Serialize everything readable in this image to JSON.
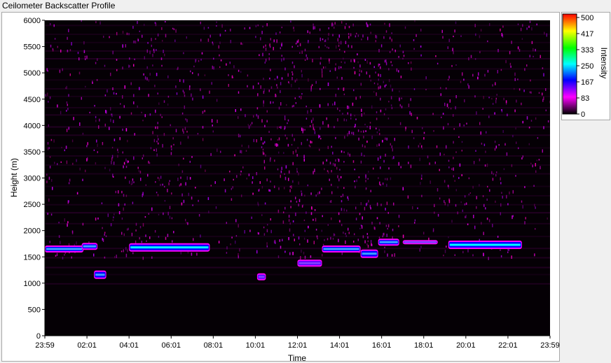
{
  "window": {
    "title": "Ceilometer Backscatter Profile"
  },
  "chart_data": {
    "type": "heatmap",
    "title": "Ceilometer Backscatter Profile",
    "xlabel": "Time",
    "ylabel": "Height (m)",
    "x_ticks": [
      "23:59",
      "02:01",
      "04:01",
      "06:01",
      "08:01",
      "10:01",
      "12:01",
      "14:01",
      "16:01",
      "18:01",
      "20:01",
      "22:01",
      "23:59"
    ],
    "y_ticks": [
      0,
      500,
      1000,
      1500,
      2000,
      2500,
      3000,
      3500,
      4000,
      4500,
      5000,
      5500,
      6000
    ],
    "ylim": [
      0,
      6000
    ],
    "colorbar": {
      "label": "Intensity",
      "ticks": [
        "500",
        "417",
        "333",
        "250",
        "167",
        "83",
        "0"
      ],
      "range": [
        0,
        500
      ],
      "colors": [
        "#000000",
        "#ff00ff",
        "#0000ff",
        "#00ffff",
        "#00ff00",
        "#ffff00",
        "#ff0000"
      ]
    },
    "grid": false,
    "cloud_layers": [
      {
        "start": "00:00",
        "end": "01:50",
        "height_m": 1650,
        "intensity": 210
      },
      {
        "start": "01:45",
        "end": "02:30",
        "height_m": 1700,
        "intensity": 230
      },
      {
        "start": "02:20",
        "end": "02:55",
        "height_m": 1160,
        "intensity": 260
      },
      {
        "start": "04:00",
        "end": "07:50",
        "height_m": 1680,
        "intensity": 280
      },
      {
        "start": "10:05",
        "end": "10:30",
        "height_m": 1120,
        "intensity": 200
      },
      {
        "start": "12:00",
        "end": "13:10",
        "height_m": 1380,
        "intensity": 200
      },
      {
        "start": "13:10",
        "end": "15:00",
        "height_m": 1650,
        "intensity": 220
      },
      {
        "start": "15:00",
        "end": "15:50",
        "height_m": 1560,
        "intensity": 260
      },
      {
        "start": "15:50",
        "end": "16:50",
        "height_m": 1780,
        "intensity": 210
      },
      {
        "start": "17:00",
        "end": "18:40",
        "height_m": 1780,
        "intensity": 120
      },
      {
        "start": "19:10",
        "end": "22:40",
        "height_m": 1730,
        "intensity": 290
      }
    ]
  }
}
